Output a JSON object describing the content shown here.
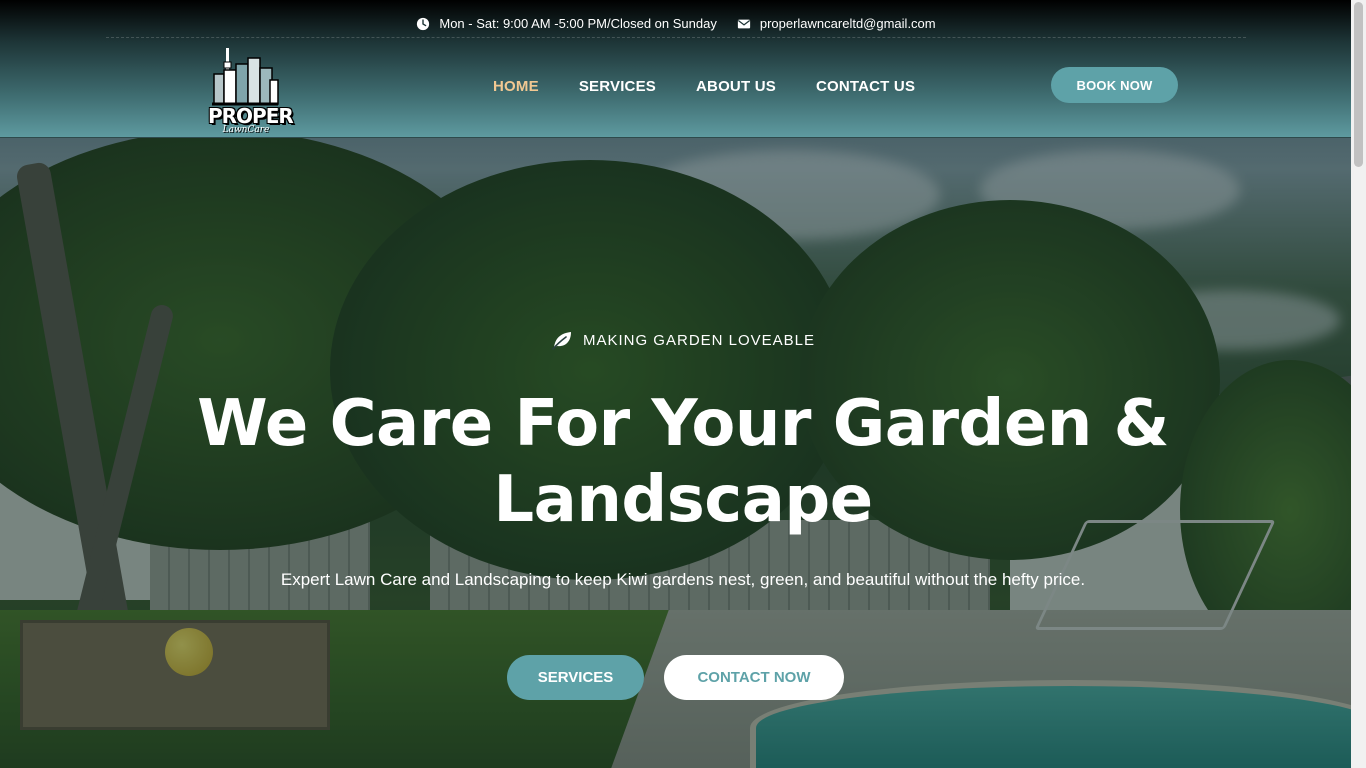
{
  "topbar": {
    "hours": "Mon - Sat: 9:00 AM -5:00 PM/Closed on Sunday",
    "email": "properlawncareltd@gmail.com",
    "hours_icon": "clock-icon",
    "email_icon": "envelope-icon"
  },
  "logo": {
    "word": "PROPER",
    "sub": "LawnCare"
  },
  "nav": {
    "items": [
      {
        "label": "HOME",
        "active": true
      },
      {
        "label": "SERVICES",
        "active": false
      },
      {
        "label": "ABOUT US",
        "active": false
      },
      {
        "label": "CONTACT US",
        "active": false
      }
    ]
  },
  "header": {
    "book_label": "BOOK NOW"
  },
  "hero": {
    "eyebrow": "MAKING GARDEN LOVEABLE",
    "eyebrow_icon": "leaf-icon",
    "headline_line1": "We Care For Your Garden &",
    "headline_line2": "Landscape",
    "subline": "Expert Lawn Care and Landscaping to keep Kiwi gardens nest, green, and beautiful without the hefty price.",
    "primary_button": "SERVICES",
    "secondary_button": "CONTACT NOW"
  },
  "colors": {
    "accent": "#5ea2a8",
    "nav_active": "#f1c892",
    "text": "#ffffff"
  }
}
